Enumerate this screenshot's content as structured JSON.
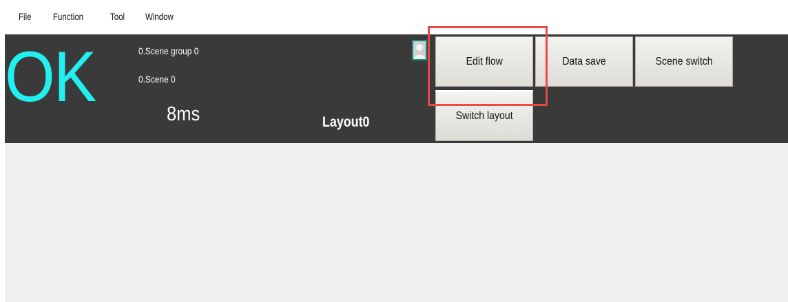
{
  "menu": {
    "items": [
      "File",
      "Function",
      "Tool",
      "Window"
    ]
  },
  "status": {
    "result": "OK",
    "result_color": "#22f0f0",
    "scene_group": "0.Scene group 0",
    "scene": "0.Scene 0",
    "time": "8ms",
    "layout": "Layout0"
  },
  "icons": {
    "user": "user-avatar-icon"
  },
  "buttons": {
    "edit_flow": "Edit flow",
    "data_save": "Data save",
    "scene_switch": "Scene switch",
    "switch_layout": "Switch layout"
  },
  "colors": {
    "toolbar_bg": "#3a3a3a",
    "highlight": "#e84a4a",
    "workspace_bg": "#f0f0f0"
  }
}
